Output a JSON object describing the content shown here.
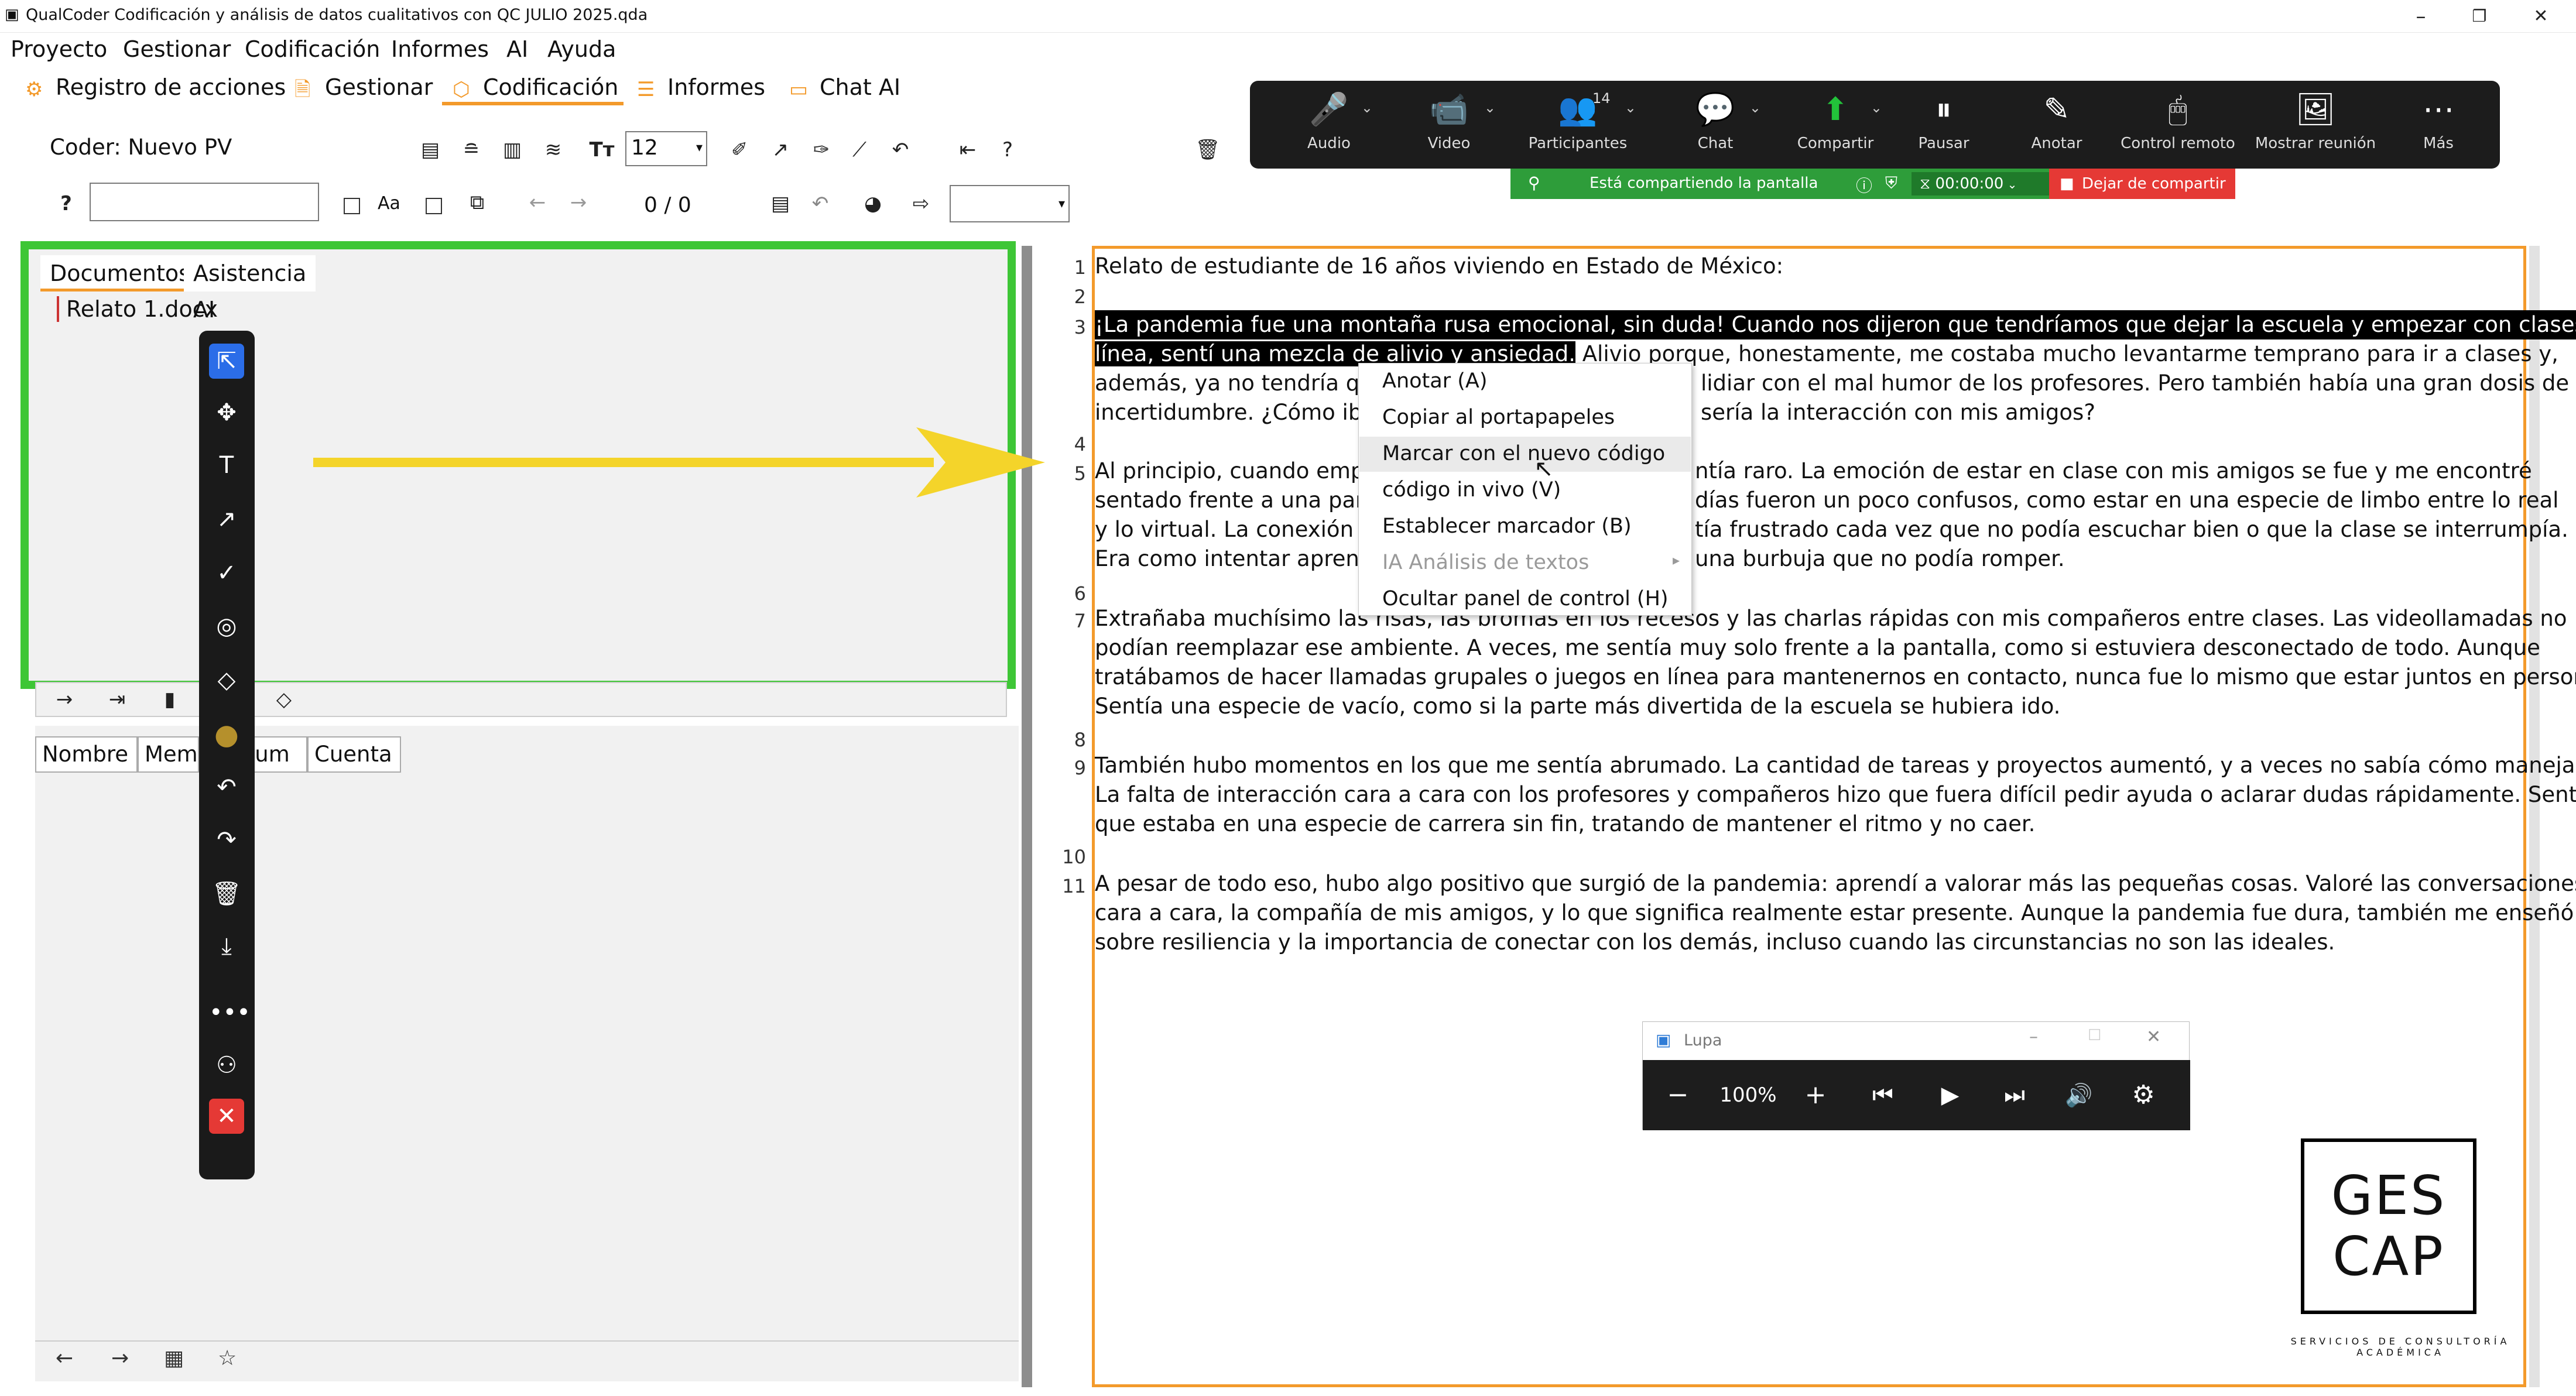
{
  "window": {
    "title": "QualCoder Codificación y análisis de datos cualitativos con QC JULIO 2025.qda",
    "minimize": "–",
    "restore": "❐",
    "close": "✕"
  },
  "menubar": [
    "Proyecto",
    "Gestionar",
    "Codificación",
    "Informes",
    "AI",
    "Ayuda"
  ],
  "tabs": [
    {
      "label": "Registro de acciones",
      "icon": "gear-icon"
    },
    {
      "label": "Gestionar",
      "icon": "document-icon"
    },
    {
      "label": "Codificación",
      "icon": "tag-icon",
      "active": true
    },
    {
      "label": "Informes",
      "icon": "list-icon"
    },
    {
      "label": "Chat AI",
      "icon": "chat-icon"
    }
  ],
  "toolbar": {
    "coder_label": "Coder: Nuevo PV",
    "font_size": "12",
    "help": "?",
    "case_label": "Aa",
    "counter": "0 / 0"
  },
  "zoom": {
    "items": [
      {
        "label": "Audio",
        "icon": "🎤"
      },
      {
        "label": "Video",
        "icon": "📹"
      },
      {
        "label": "Participantes",
        "icon": "👥",
        "badge": "14"
      },
      {
        "label": "Chat",
        "icon": "💬"
      },
      {
        "label": "Compartir",
        "icon": "⬆"
      },
      {
        "label": "Pausar",
        "icon": "⏸"
      },
      {
        "label": "Anotar",
        "icon": "✎"
      },
      {
        "label": "Control remoto",
        "icon": "🖱"
      },
      {
        "label": "Mostrar reunión",
        "icon": "🖼"
      },
      {
        "label": "Más",
        "icon": "⋯"
      }
    ],
    "sharing_text": "Está compartiendo la pantalla",
    "timer": "00:00:00",
    "stop_share": "Dejar de compartir"
  },
  "documents_panel": {
    "tabs": [
      "Documentos",
      "Asistencia AI"
    ],
    "files": [
      "Relato 1.docx"
    ]
  },
  "codes_table": {
    "columns": [
      "Nombre",
      "Mem",
      "lum",
      "Cuenta"
    ]
  },
  "document_text": [
    {
      "n": "1",
      "text": "Relato de estudiante de 16 años viviendo en Estado de México:"
    },
    {
      "n": "2",
      "text": ""
    },
    {
      "n": "3",
      "text": "¡La pandemia fue una montaña rusa emocional, sin duda! Cuando nos dijeron que tendríamos que dejar la escuela y empezar con clases en"
    },
    {
      "n": "",
      "text_sel": "línea, sentí una mezcla de alivio y ansiedad.",
      "text": " Alivio porque, honestamente, me costaba mucho levantarme temprano para ir a clases y,"
    },
    {
      "n": "",
      "text": "además, ya no tendría que",
      "text2": "lidiar con el mal humor de los profesores. Pero también había una gran dosis de"
    },
    {
      "n": "",
      "text": "incertidumbre. ¿Cómo iba",
      "text2": "sería la interacción con mis amigos?"
    },
    {
      "n": "4",
      "text": ""
    },
    {
      "n": "5",
      "text": "Al principio, cuando empe",
      "text2": "ntía raro. La emoción de estar en clase con mis amigos se fue y me encontré"
    },
    {
      "n": "",
      "text": "sentado frente a una pant",
      "text2": "días fueron un poco confusos, como estar en una especie de limbo entre lo real"
    },
    {
      "n": "",
      "text": "y lo virtual. La conexión a I",
      "text2": "tía frustrado cada vez que no podía escuchar bien o que la clase se interrumpía."
    },
    {
      "n": "",
      "text": "Era como intentar aprend",
      "text2": "una burbuja que no podía romper."
    },
    {
      "n": "6",
      "text": ""
    },
    {
      "n": "7",
      "text": "Extrañaba muchísimo las risas, las bromas en los recesos y las charlas rápidas con mis compañeros entre clases. Las videollamadas no"
    },
    {
      "n": "",
      "text": "podían reemplazar ese ambiente. A veces, me sentía muy solo frente a la pantalla, como si estuviera desconectado de todo. Aunque"
    },
    {
      "n": "",
      "text": "tratábamos de hacer llamadas grupales o juegos en línea para mantenernos en contacto, nunca fue lo mismo que estar juntos en persona."
    },
    {
      "n": "",
      "text": "Sentía una especie de vacío, como si la parte más divertida de la escuela se hubiera ido."
    },
    {
      "n": "8",
      "text": ""
    },
    {
      "n": "9",
      "text": "También hubo momentos en los que me sentía abrumado. La cantidad de tareas y proyectos aumentó, y a veces no sabía cómo manejarlo."
    },
    {
      "n": "",
      "text": "La falta de interacción cara a cara con los profesores y compañeros hizo que fuera difícil pedir ayuda o aclarar dudas rápidamente. Sentía"
    },
    {
      "n": "",
      "text": "que estaba en una especie de carrera sin fin, tratando de mantener el ritmo y no caer."
    },
    {
      "n": "10",
      "text": ""
    },
    {
      "n": "11",
      "text": "A pesar de todo eso, hubo algo positivo que surgió de la pandemia: aprendí a valorar más las pequeñas cosas. Valoré las conversaciones"
    },
    {
      "n": "",
      "text": "cara a cara, la compañía de mis amigos, y lo que significa realmente estar presente. Aunque la pandemia fue dura, también me enseñó"
    },
    {
      "n": "",
      "text": "sobre resiliencia y la importancia de conectar con los demás, incluso cuando las circunstancias no son las ideales."
    }
  ],
  "context_menu": [
    {
      "label": "Anotar (A)"
    },
    {
      "label": "Copiar al portapapeles"
    },
    {
      "label": "Marcar con el nuevo código",
      "hover": true
    },
    {
      "label": "código in vivo (V)"
    },
    {
      "label": "Establecer marcador (B)"
    },
    {
      "label": "IA Análisis de textos",
      "disabled": true
    },
    {
      "label": "Ocultar panel de control (H)"
    }
  ],
  "lupa": {
    "title": "Lupa",
    "zoom": "100%"
  },
  "logo": {
    "line1": "GES",
    "line2": "CAP",
    "sub": "SERVICIOS DE CONSULTORÍA ACADÉMICA"
  },
  "colors": {
    "accent": "#f39a2b",
    "highlight_box": "#3ec636",
    "arrow": "#f4d42a",
    "zoom_bg": "#1c1c1c",
    "share_green": "#2e9d3a",
    "stop_red": "#e53935"
  }
}
